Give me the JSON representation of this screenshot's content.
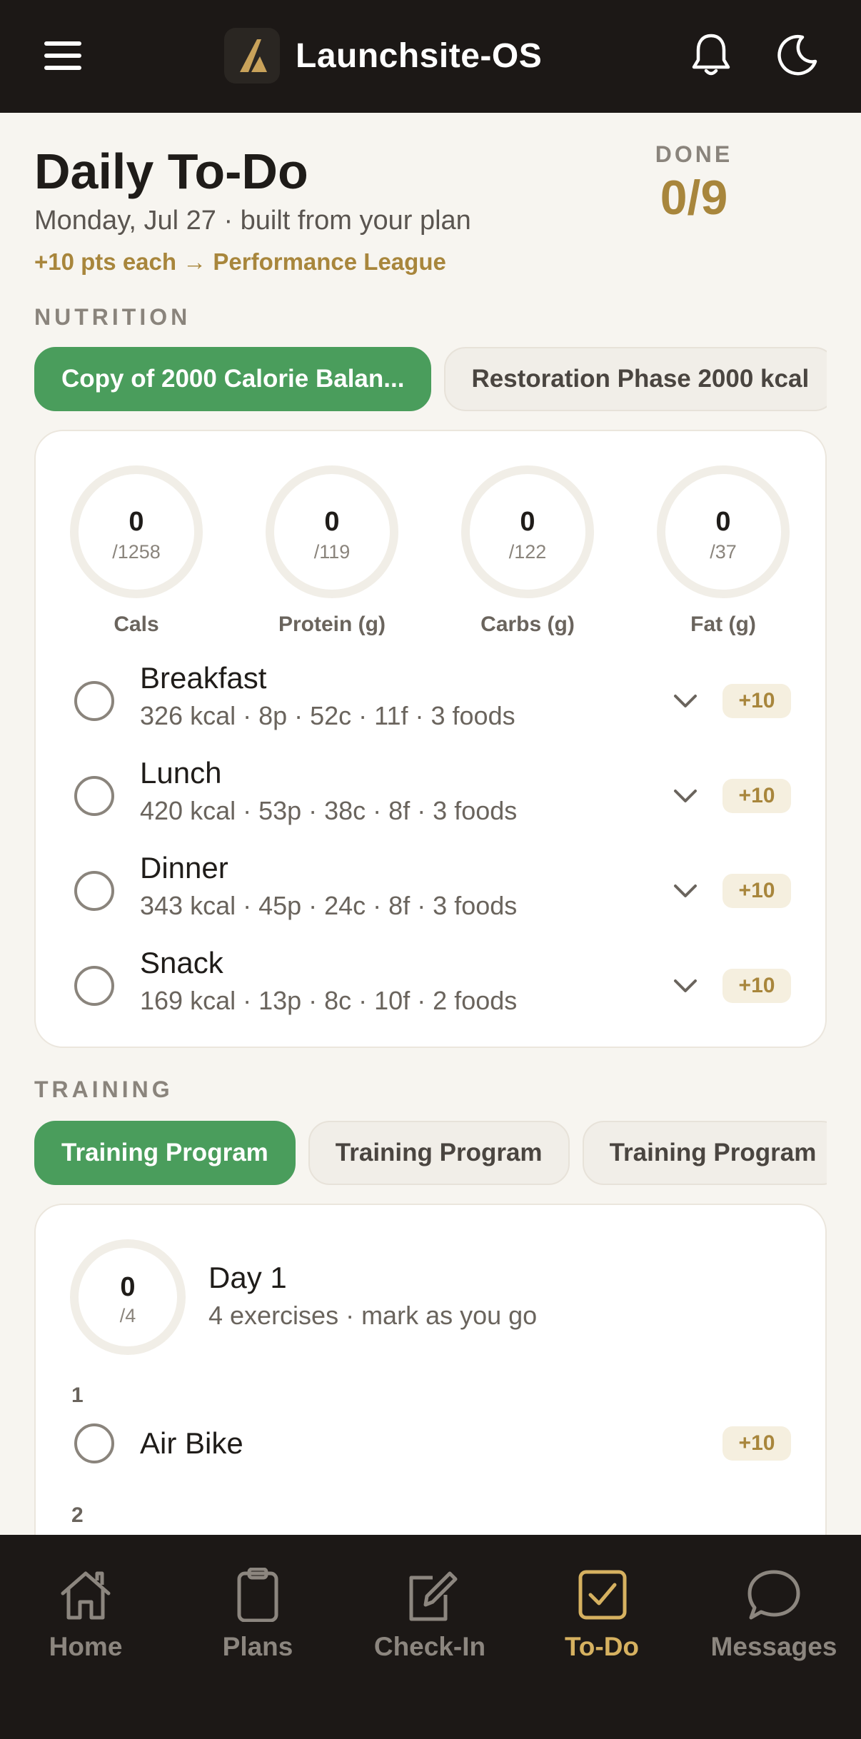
{
  "header": {
    "app_name": "Launchsite-OS",
    "menu_icon": "hamburger-menu-icon",
    "notifications_icon": "bell-icon",
    "theme_icon": "moon-icon"
  },
  "page": {
    "title": "Daily To-Do",
    "subtitle": "Monday, Jul 27 · built from your plan",
    "points_note": "+10 pts each → Performance League",
    "done_label": "DONE",
    "done_value": "0/9"
  },
  "nutrition": {
    "section_label": "NUTRITION",
    "plans": [
      {
        "label": "Copy of 2000 Calorie Balan...",
        "active": true
      },
      {
        "label": "Restoration Phase 2000 kcal",
        "active": false
      }
    ],
    "macros": [
      {
        "value": "0",
        "target": "/1258",
        "label": "Cals"
      },
      {
        "value": "0",
        "target": "/119",
        "label": "Protein (g)"
      },
      {
        "value": "0",
        "target": "/122",
        "label": "Carbs (g)"
      },
      {
        "value": "0",
        "target": "/37",
        "label": "Fat (g)"
      }
    ],
    "meals": [
      {
        "name": "Breakfast",
        "meta": "326 kcal · 8p · 52c · 11f · 3 foods",
        "points": "+10"
      },
      {
        "name": "Lunch",
        "meta": "420 kcal · 53p · 38c · 8f · 3 foods",
        "points": "+10"
      },
      {
        "name": "Dinner",
        "meta": "343 kcal · 45p · 24c · 8f · 3 foods",
        "points": "+10"
      },
      {
        "name": "Snack",
        "meta": "169 kcal · 13p · 8c · 10f · 2 foods",
        "points": "+10"
      }
    ]
  },
  "training": {
    "section_label": "TRAINING",
    "programs": [
      {
        "label": "Training Program",
        "active": true
      },
      {
        "label": "Training Program",
        "active": false
      },
      {
        "label": "Training Program",
        "active": false
      }
    ],
    "day": {
      "progress_value": "0",
      "progress_target": "/4",
      "title": "Day 1",
      "meta": "4 exercises · mark as you go"
    },
    "exercises": [
      {
        "number": "1",
        "name": "Air Bike",
        "points": "+10"
      },
      {
        "number": "2",
        "name": "",
        "points": ""
      }
    ]
  },
  "nav": {
    "items": [
      {
        "label": "Home",
        "icon": "home-icon"
      },
      {
        "label": "Plans",
        "icon": "clipboard-icon"
      },
      {
        "label": "Check-In",
        "icon": "edit-icon"
      },
      {
        "label": "To-Do",
        "icon": "checkbox-icon",
        "active": true
      },
      {
        "label": "Messages",
        "icon": "chat-bubble-icon"
      }
    ]
  },
  "colors": {
    "header_bg": "#1c1816",
    "accent_gold": "#a8863c",
    "active_green": "#4a9d5c",
    "nav_active": "#d6b160",
    "page_bg": "#f7f5f0"
  }
}
